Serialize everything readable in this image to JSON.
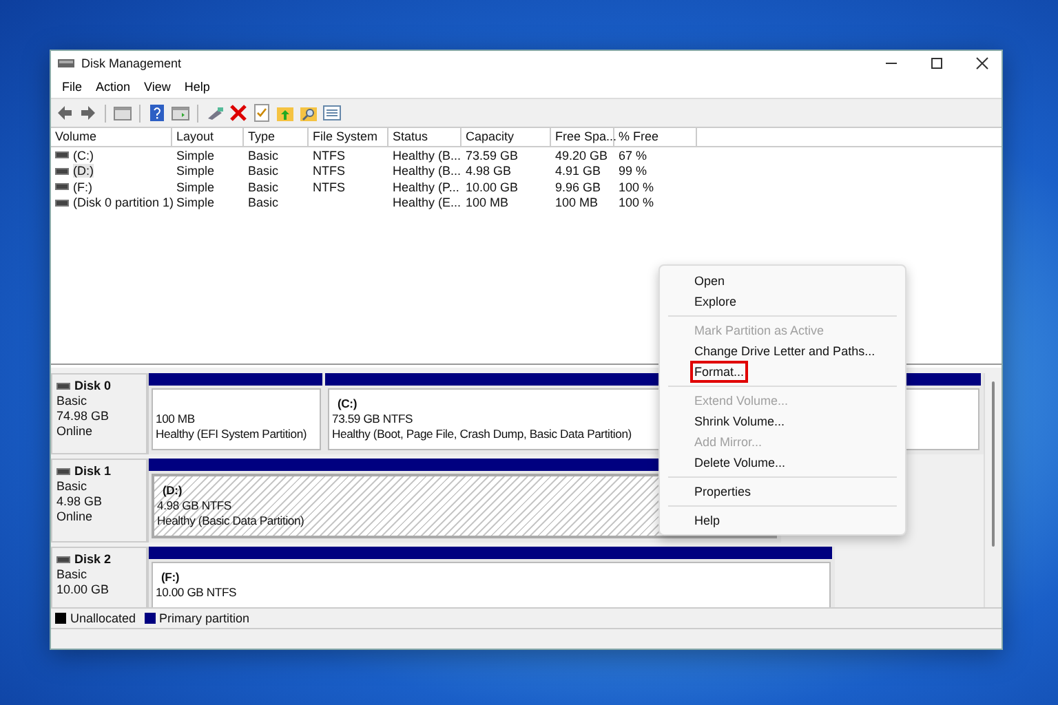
{
  "window": {
    "title": "Disk Management"
  },
  "menu": [
    "File",
    "Action",
    "View",
    "Help"
  ],
  "toolbar": [
    {
      "kind": "back"
    },
    {
      "kind": "forward"
    },
    {
      "kind": "sep"
    },
    {
      "kind": "console"
    },
    {
      "kind": "sep"
    },
    {
      "kind": "help"
    },
    {
      "kind": "panel"
    },
    {
      "kind": "sep"
    },
    {
      "kind": "connect"
    },
    {
      "kind": "delete"
    },
    {
      "kind": "check"
    },
    {
      "kind": "folder-up"
    },
    {
      "kind": "folder-search"
    },
    {
      "kind": "list"
    }
  ],
  "table": {
    "columns": [
      "Volume",
      "Layout",
      "Type",
      "File System",
      "Status",
      "Capacity",
      "Free Spa...",
      "% Free"
    ],
    "rows": [
      {
        "selected": false,
        "cells": [
          "(C:)",
          "Simple",
          "Basic",
          "NTFS",
          "Healthy (B...",
          "73.59 GB",
          "49.20 GB",
          "67 %"
        ]
      },
      {
        "selected": true,
        "cells": [
          "(D:)",
          "Simple",
          "Basic",
          "NTFS",
          "Healthy (B...",
          "4.98 GB",
          "4.91 GB",
          "99 %"
        ]
      },
      {
        "selected": false,
        "cells": [
          "(F:)",
          "Simple",
          "Basic",
          "NTFS",
          "Healthy (P...",
          "10.00 GB",
          "9.96 GB",
          "100 %"
        ]
      },
      {
        "selected": false,
        "cells": [
          "(Disk 0 partition 1)",
          "Simple",
          "Basic",
          "",
          "Healthy (E...",
          "100 MB",
          "100 MB",
          "100 %"
        ]
      }
    ]
  },
  "disks": [
    {
      "name": "Disk 0",
      "lines": [
        "Basic",
        "74.98 GB",
        "Online"
      ],
      "partitions": [
        {
          "selected": false,
          "size": "100 MB",
          "status": "Healthy (EFI System Partition)"
        },
        {
          "selected": false,
          "label": "(C:)",
          "size": "73.59 GB NTFS",
          "status": "Healthy (Boot, Page File, Crash Dump, Basic Data Partition)"
        }
      ]
    },
    {
      "name": "Disk 1",
      "lines": [
        "Basic",
        "4.98 GB",
        "Online"
      ],
      "partitions": [
        {
          "selected": true,
          "label": "(D:)",
          "size": "4.98 GB NTFS",
          "status": "Healthy (Basic Data Partition)"
        }
      ]
    },
    {
      "name": "Disk 2",
      "lines": [
        "Basic",
        "10.00 GB"
      ],
      "partitions": [
        {
          "selected": false,
          "label": "(F:)",
          "size": "10.00 GB NTFS"
        }
      ]
    }
  ],
  "legend": [
    {
      "label": "Unallocated",
      "color": "#000000"
    },
    {
      "label": "Primary partition",
      "color": "#000080"
    }
  ],
  "context_menu": [
    {
      "kind": "item",
      "label": "Open",
      "disabled": false,
      "highlighted": false
    },
    {
      "kind": "item",
      "label": "Explore",
      "disabled": false,
      "highlighted": false
    },
    {
      "kind": "separator"
    },
    {
      "kind": "item",
      "label": "Mark Partition as Active",
      "disabled": true,
      "highlighted": false
    },
    {
      "kind": "item",
      "label": "Change Drive Letter and Paths...",
      "disabled": false,
      "highlighted": false
    },
    {
      "kind": "item",
      "label": "Format...",
      "disabled": false,
      "highlighted": true
    },
    {
      "kind": "separator"
    },
    {
      "kind": "item",
      "label": "Extend Volume...",
      "disabled": true,
      "highlighted": false
    },
    {
      "kind": "item",
      "label": "Shrink Volume...",
      "disabled": false,
      "highlighted": false
    },
    {
      "kind": "item",
      "label": "Add Mirror...",
      "disabled": true,
      "highlighted": false
    },
    {
      "kind": "item",
      "label": "Delete Volume...",
      "disabled": false,
      "highlighted": false
    },
    {
      "kind": "separator"
    },
    {
      "kind": "item",
      "label": "Properties",
      "disabled": false,
      "highlighted": false
    },
    {
      "kind": "separator"
    },
    {
      "kind": "item",
      "label": "Help",
      "disabled": false,
      "highlighted": false
    }
  ]
}
